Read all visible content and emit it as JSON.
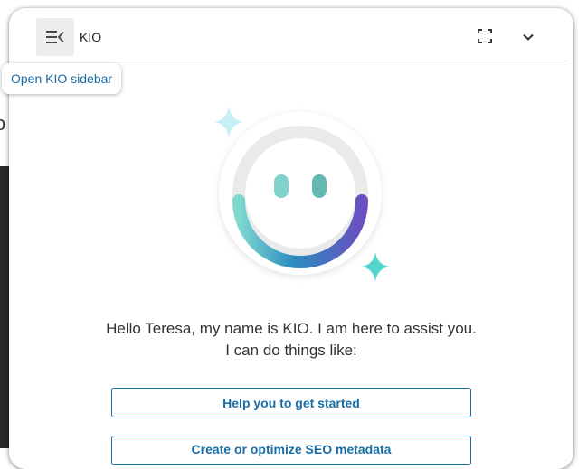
{
  "background": {
    "partial_letter": "o"
  },
  "header": {
    "app_name": "KIO",
    "menu_icon": "sidebar-menu-icon",
    "fullscreen_icon": "fullscreen-icon",
    "collapse_icon": "chevron-down-icon"
  },
  "tooltip": {
    "text": "Open KIO sidebar"
  },
  "mascot": {
    "icon": "kio-smiley-mascot"
  },
  "greeting": {
    "line1": "Hello Teresa, my name is KIO. I am here to assist you.",
    "line2": "I can do things like:"
  },
  "actions": [
    {
      "label": "Help you to get started"
    },
    {
      "label": "Create or optimize SEO metadata"
    }
  ],
  "colors": {
    "accent": "#1a6ea6",
    "sparkle_light": "#bfeff6",
    "sparkle_teal": "#52d6cf",
    "eye": "#7fd3cc"
  }
}
